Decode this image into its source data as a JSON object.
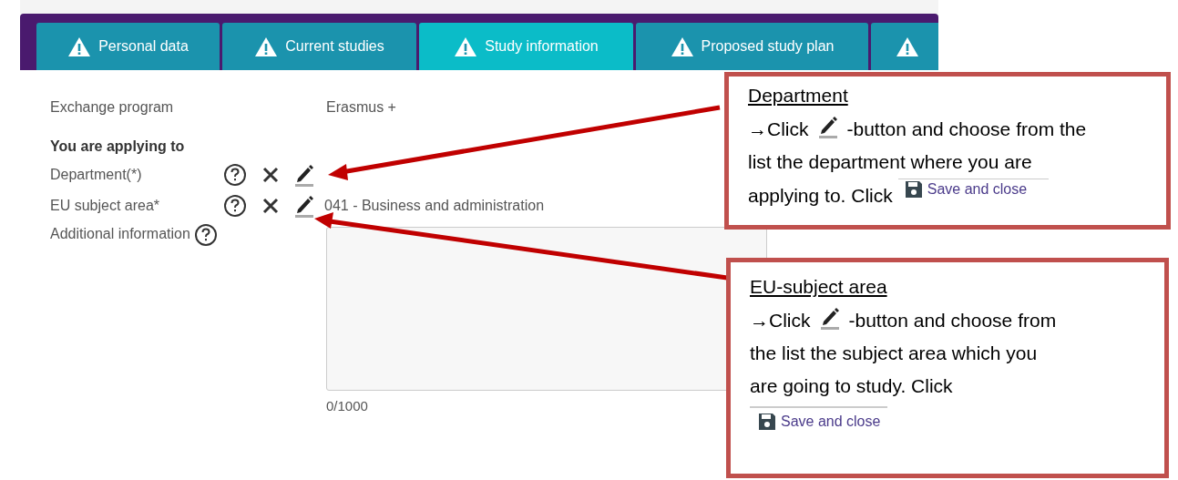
{
  "tabs": [
    {
      "label": "Personal data",
      "selected": false
    },
    {
      "label": "Current studies",
      "selected": false
    },
    {
      "label": "Study information",
      "selected": true
    },
    {
      "label": "Proposed study plan",
      "selected": false
    },
    {
      "selected": false
    }
  ],
  "form": {
    "rows": [
      {
        "kind": "static",
        "label": "Exchange program",
        "value": "Erasmus +"
      },
      {
        "kind": "heading",
        "label": "You are applying to"
      },
      {
        "kind": "lookup",
        "label": "Department(*)"
      },
      {
        "kind": "lookup",
        "label": "EU subject area*",
        "value": "041 - Business and administration"
      },
      {
        "kind": "textarea",
        "label": "Additional information",
        "counter": "0/1000"
      }
    ]
  },
  "callouts": [
    {
      "kind": "inline",
      "title": "Department",
      "prefix": "→Click",
      "lines": [
        "-button and choose from the",
        "list the department where you are",
        "applying to. Click"
      ],
      "button": "Save and close"
    },
    {
      "kind": "below",
      "title": "EU-subject area",
      "prefix": "→Click",
      "lines": [
        "-button and choose from",
        "the list the subject area which you",
        "are going to study. Click"
      ],
      "button": "Save and close"
    }
  ]
}
